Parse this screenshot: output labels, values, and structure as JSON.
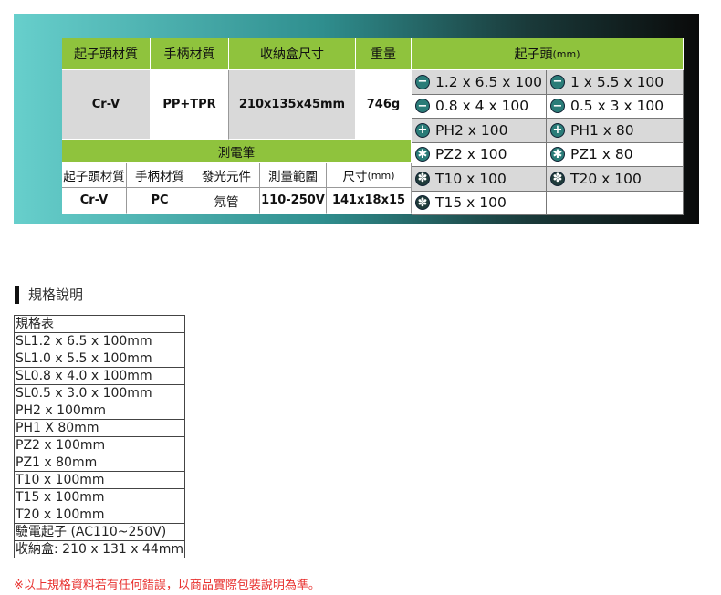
{
  "spec_table": {
    "headers": [
      "起子頭材質",
      "手柄材質",
      "收納盒尺寸",
      "重量"
    ],
    "values": [
      "Cr-V",
      "PP+TPR",
      "210x135x45mm",
      "746g"
    ],
    "bits_header": "起子頭",
    "bits_header_unit": "(mm)",
    "pen_title": "測電筆",
    "pen_headers": [
      "起子頭材質",
      "手柄材質",
      "發光元件",
      "測量範圍",
      "尺寸"
    ],
    "pen_header_unit": "(mm)",
    "pen_values": [
      "Cr-V",
      "PC",
      "氖管",
      "110-250V",
      "141x18x15"
    ],
    "bits": [
      [
        {
          "icon": "slotted",
          "label": "1.2 x 6.5 x 100"
        },
        {
          "icon": "slotted",
          "label": "1 x 5.5 x 100"
        }
      ],
      [
        {
          "icon": "slotted",
          "label": "0.8 x 4 x 100"
        },
        {
          "icon": "slotted",
          "label": "0.5 x 3 x 100"
        }
      ],
      [
        {
          "icon": "phillips",
          "label": "PH2 x 100"
        },
        {
          "icon": "phillips",
          "label": "PH1 x 80"
        }
      ],
      [
        {
          "icon": "pozidriv",
          "label": "PZ2 x 100"
        },
        {
          "icon": "pozidriv",
          "label": "PZ1 x 80"
        }
      ],
      [
        {
          "icon": "torx",
          "label": "T10 x 100"
        },
        {
          "icon": "torx",
          "label": "T20 x 100"
        }
      ],
      [
        {
          "icon": "torx",
          "label": "T15 x 100"
        },
        {
          "icon": "",
          "label": ""
        }
      ]
    ]
  },
  "section": {
    "title": "規格說明"
  },
  "spec_list": [
    "規格表",
    "SL1.2 x 6.5 x 100mm",
    "SL1.0 x 5.5 x 100mm",
    "SL0.8 x 4.0 x 100mm",
    "SL0.5 x 3.0 x 100mm",
    "PH2 x 100mm",
    "PH1 X 80mm",
    "PZ2 x 100mm",
    "PZ1 x 80mm",
    "T10 x 100mm",
    "T15 x 100mm",
    "T20 x 100mm",
    "驗電起子 (AC110~250V)",
    "收納盒: 210 x 131 x 44mm"
  ],
  "note": "※以上規格資料若有任何錯誤，以商品實際包裝說明為準。"
}
